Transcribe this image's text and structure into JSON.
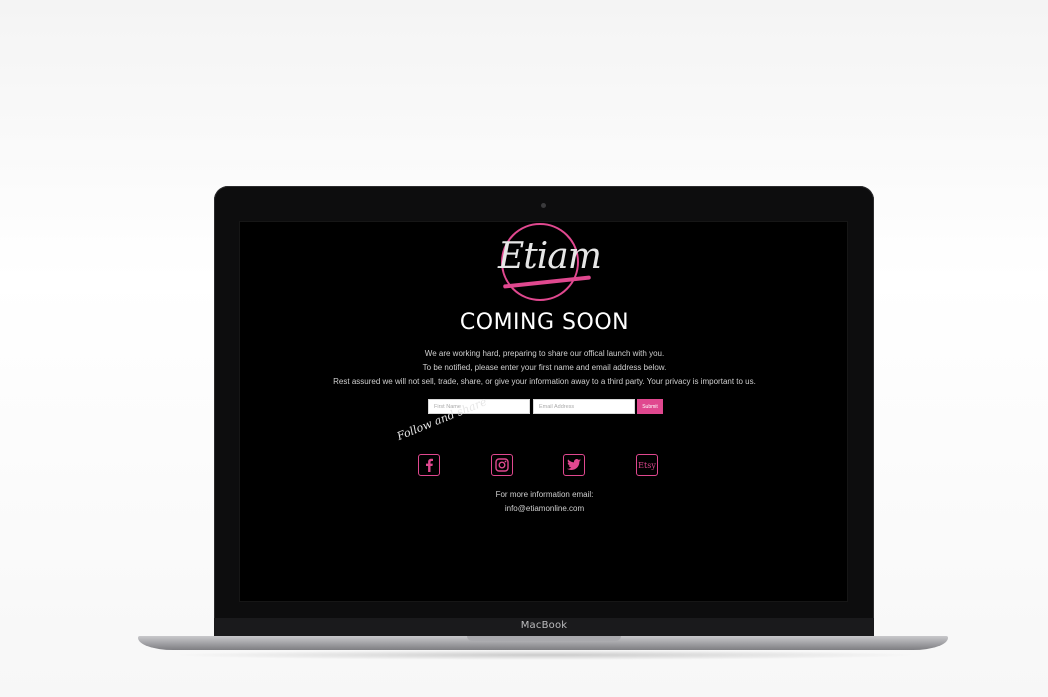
{
  "device": {
    "brand_label": "MacBook"
  },
  "logo": {
    "text": "Etiam"
  },
  "page": {
    "title": "COMING SOON",
    "description_lines": [
      "We are working hard, preparing to share our offical launch with you.",
      "To be notified, please enter your first name and email address below.",
      "Rest assured we will not sell, trade, share, or give your information away to a third party. Your privacy is important to us."
    ]
  },
  "form": {
    "first_name_placeholder": "First Name",
    "email_placeholder": "Email Address",
    "submit_label": "Submit"
  },
  "social": {
    "heading": "Follow and share",
    "icons": [
      "facebook-icon",
      "instagram-icon",
      "twitter-icon",
      "etsy-icon"
    ],
    "etsy_label": "Etsy"
  },
  "contact": {
    "label": "For more information email:",
    "email": "info@etiamonline.com"
  },
  "colors": {
    "accent": "#e0488f",
    "screen_bg": "#000000",
    "text": "#ffffff"
  }
}
